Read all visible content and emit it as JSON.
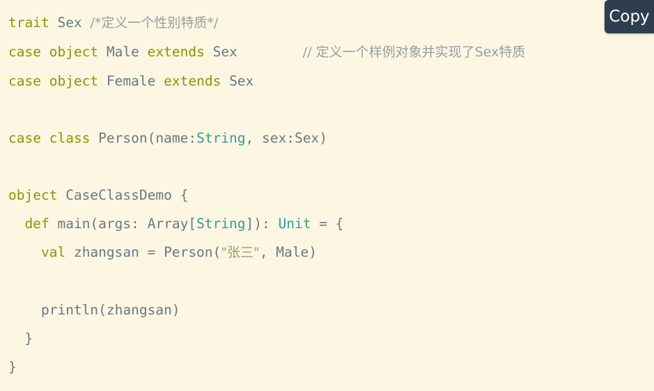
{
  "editor": {
    "language": "scala",
    "background_color": "#fdf6e3",
    "default_text_color": "#657b83",
    "keyword_color": "#859900",
    "type_color": "#2aa198",
    "string_color": "#93a565",
    "comment_color": "#93a1a1"
  },
  "toolbar": {
    "copy_label": "Copy",
    "copy_button_color": "#2f3e4e",
    "copy_text_color": "#ffffff"
  },
  "code": {
    "line1": {
      "keyword_trait": "trait",
      "name_sex": "Sex",
      "comment": "/*定义一个性别特质*/"
    },
    "line2": {
      "keyword_case": "case",
      "keyword_object": "object",
      "name_male": "Male",
      "keyword_extends": "extends",
      "name_sex": "Sex",
      "trailing_comment": "// 定义一个样例对象并实现了Sex特质"
    },
    "line3": {
      "keyword_case": "case",
      "keyword_object": "object",
      "name_female": "Female",
      "keyword_extends": "extends",
      "name_sex": "Sex"
    },
    "line5": {
      "keyword_case": "case",
      "keyword_class": "class",
      "name_person": "Person",
      "paren_open": "(",
      "param_name": "name:",
      "type_string": "String",
      "comma": ", ",
      "param_sex": "sex:Sex",
      "paren_close": ")"
    },
    "line7": {
      "keyword_object": "object",
      "name_demo": "CaseClassDemo",
      "brace_open": "{"
    },
    "line8": {
      "indent": "  ",
      "keyword_def": "def",
      "name_main": "main(args: Array[",
      "type_string": "String",
      "after_type": "]): ",
      "type_unit": "Unit",
      "assign": " = {"
    },
    "line9": {
      "indent": "    ",
      "keyword_val": "val",
      "name_var": "zhangsan = Person(",
      "string_literal": "\"张三\"",
      "args_rest": ", Male)"
    },
    "line11": {
      "indent": "    ",
      "call": "println(zhangsan)"
    },
    "line12": {
      "indent": "  ",
      "brace_close": "}"
    },
    "line13": {
      "brace_close": "}"
    }
  }
}
